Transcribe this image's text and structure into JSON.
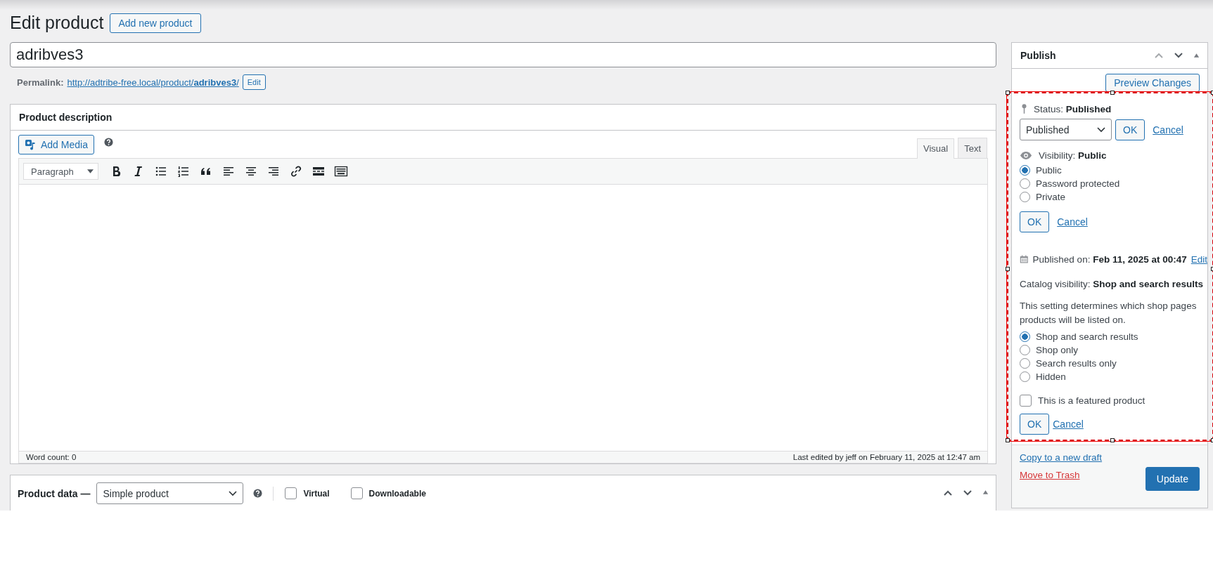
{
  "page_title": "Edit product",
  "add_new_button": "Add new product",
  "post_title": {
    "value": "adribves3"
  },
  "permalink": {
    "label": "Permalink:",
    "url": "http://adtribe-free.local/product/**adribves3**/",
    "edit_button": "Edit"
  },
  "description_box": {
    "title": "Product description",
    "add_media": "Add Media",
    "tabs": [
      {
        "label": "Visual",
        "selected": true
      },
      {
        "label": "Text",
        "selected": false
      }
    ],
    "format_select": "Paragraph",
    "word_count": "Word count: 0",
    "last_edited": "Last edited by jeff on February 11, 2025 at 12:47 am"
  },
  "product_data": {
    "title": "Product data —",
    "type_select": "Simple product",
    "options": [
      {
        "label": "Virtual",
        "checked": false
      },
      {
        "label": "Downloadable",
        "checked": false
      }
    ]
  },
  "publish": {
    "title": "Publish",
    "preview_button": "Preview Changes",
    "status": {
      "text": "Status: **Published**",
      "select": "Published",
      "ok": "OK",
      "cancel": "Cancel"
    },
    "visibility": {
      "text": "Visibility: **Public**",
      "options": [
        {
          "label": "Public",
          "selected": true
        },
        {
          "label": "Password protected",
          "selected": false
        },
        {
          "label": "Private",
          "selected": false
        }
      ],
      "ok": "OK",
      "cancel": "Cancel"
    },
    "published_on": {
      "text": "Published on: **Feb 11, 2025 at 00:47**",
      "edit": "Edit"
    },
    "catalog": {
      "text": "Catalog visibility: **Shop and search results**",
      "description": "This setting determines which shop pages products will be listed on.",
      "options": [
        {
          "label": "Shop and search results",
          "selected": true
        },
        {
          "label": "Shop only",
          "selected": false
        },
        {
          "label": "Search results only",
          "selected": false
        },
        {
          "label": "Hidden",
          "selected": false
        }
      ],
      "featured": {
        "label": "This is a featured product",
        "checked": false
      },
      "ok": "OK",
      "cancel": "Cancel"
    },
    "copy_link": "Copy to a new draft",
    "trash_link": "Move to Trash",
    "update_button": "Update"
  }
}
